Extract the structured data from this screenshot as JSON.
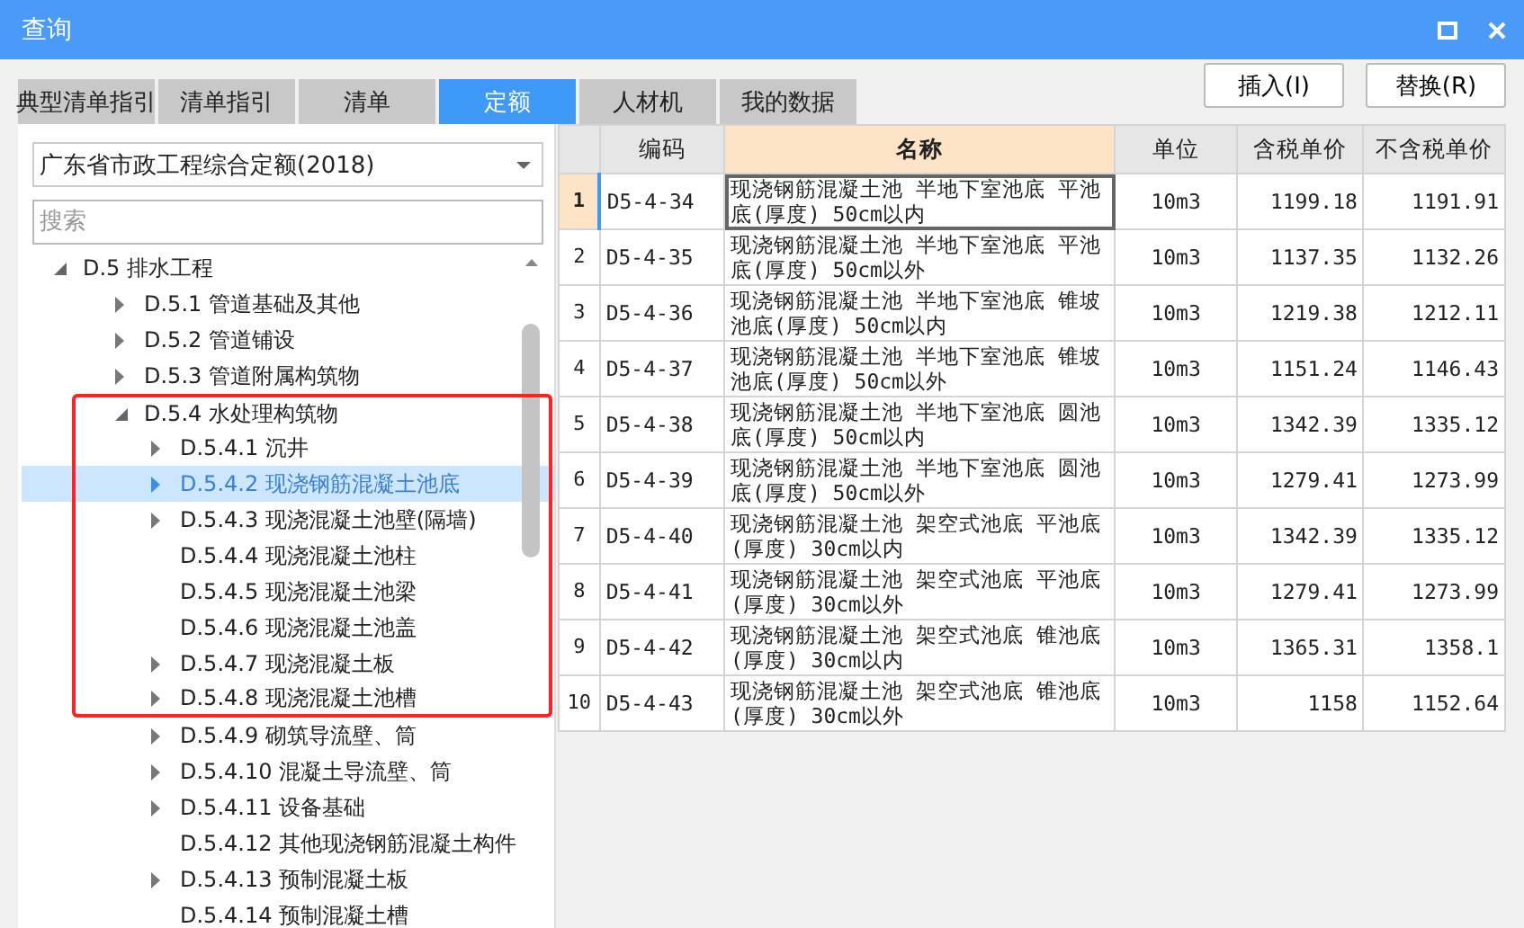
{
  "window": {
    "title": "查询"
  },
  "tabs": [
    {
      "label": "典型清单指引",
      "selected": false
    },
    {
      "label": "清单指引",
      "selected": false
    },
    {
      "label": "清单",
      "selected": false
    },
    {
      "label": "定额",
      "selected": true
    },
    {
      "label": "人材机",
      "selected": false
    },
    {
      "label": "我的数据",
      "selected": false
    }
  ],
  "buttons": [
    "插入(I)",
    "替换(R)"
  ],
  "library_select": {
    "value": "广东省市政工程综合定额(2018)"
  },
  "search": {
    "placeholder": "搜索"
  },
  "tree": [
    {
      "label": "D.5 排水工程",
      "expanded": true,
      "selected": false,
      "highlighted": false,
      "children": [
        {
          "label": "D.5.1 管道基础及其他",
          "expanded": false,
          "selected": false,
          "highlighted": false
        },
        {
          "label": "D.5.2 管道铺设",
          "expanded": false,
          "selected": false,
          "highlighted": false
        },
        {
          "label": "D.5.3 管道附属构筑物",
          "expanded": false,
          "selected": false,
          "highlighted": false
        },
        {
          "label": "D.5.4 水处理构筑物",
          "expanded": true,
          "selected": false,
          "highlighted": true,
          "children": [
            {
              "label": "D.5.4.1 沉井",
              "expanded": false,
              "selected": false,
              "highlighted": true
            },
            {
              "label": "D.5.4.2 现浇钢筋混凝土池底",
              "expanded": false,
              "selected": true,
              "highlighted": true
            },
            {
              "label": "D.5.4.3 现浇混凝土池壁(隔墙)",
              "expanded": false,
              "selected": false,
              "highlighted": true
            },
            {
              "label": "D.5.4.4 现浇混凝土池柱",
              "selected": false,
              "highlighted": true
            },
            {
              "label": "D.5.4.5 现浇混凝土池梁",
              "selected": false,
              "highlighted": true
            },
            {
              "label": "D.5.4.6 现浇混凝土池盖",
              "selected": false,
              "highlighted": true
            },
            {
              "label": "D.5.4.7 现浇混凝土板",
              "expanded": false,
              "selected": false,
              "highlighted": true
            },
            {
              "label": "D.5.4.8 现浇混凝土池槽",
              "expanded": false,
              "selected": false,
              "highlighted": true
            },
            {
              "label": "D.5.4.9 砌筑导流壁、筒",
              "expanded": false,
              "selected": false,
              "highlighted": false
            },
            {
              "label": "D.5.4.10 混凝土导流壁、筒",
              "expanded": false,
              "selected": false,
              "highlighted": false
            },
            {
              "label": "D.5.4.11 设备基础",
              "expanded": false,
              "selected": false,
              "highlighted": false
            },
            {
              "label": "D.5.4.12 其他现浇钢筋混凝土构件",
              "selected": false,
              "highlighted": false
            },
            {
              "label": "D.5.4.13 预制混凝土板",
              "expanded": false,
              "selected": false,
              "highlighted": false
            },
            {
              "label": "D.5.4.14 预制混凝土槽",
              "selected": false,
              "highlighted": false
            }
          ]
        }
      ]
    }
  ],
  "table": {
    "columns": [
      {
        "label": "编码",
        "selected": false
      },
      {
        "label": "名称",
        "selected": true
      },
      {
        "label": "单位",
        "selected": false
      },
      {
        "label": "含税单价",
        "selected": false
      },
      {
        "label": "不含税单价",
        "selected": false
      }
    ],
    "rows": [
      {
        "index": "1",
        "selected": true,
        "cells": [
          "D5-4-34",
          "现浇钢筋混凝土池 半地下室池底 平池底(厚度) 50cm以内",
          "10m3",
          "1199.18",
          "1191.91"
        ]
      },
      {
        "index": "2",
        "selected": false,
        "cells": [
          "D5-4-35",
          "现浇钢筋混凝土池 半地下室池底 平池底(厚度) 50cm以外",
          "10m3",
          "1137.35",
          "1132.26"
        ]
      },
      {
        "index": "3",
        "selected": false,
        "cells": [
          "D5-4-36",
          "现浇钢筋混凝土池 半地下室池底 锥坡池底(厚度) 50cm以内",
          "10m3",
          "1219.38",
          "1212.11"
        ]
      },
      {
        "index": "4",
        "selected": false,
        "cells": [
          "D5-4-37",
          "现浇钢筋混凝土池 半地下室池底 锥坡池底(厚度) 50cm以外",
          "10m3",
          "1151.24",
          "1146.43"
        ]
      },
      {
        "index": "5",
        "selected": false,
        "cells": [
          "D5-4-38",
          "现浇钢筋混凝土池 半地下室池底 圆池底(厚度) 50cm以内",
          "10m3",
          "1342.39",
          "1335.12"
        ]
      },
      {
        "index": "6",
        "selected": false,
        "cells": [
          "D5-4-39",
          "现浇钢筋混凝土池 半地下室池底 圆池底(厚度) 50cm以外",
          "10m3",
          "1279.41",
          "1273.99"
        ]
      },
      {
        "index": "7",
        "selected": false,
        "cells": [
          "D5-4-40",
          "现浇钢筋混凝土池 架空式池底 平池底(厚度) 30cm以内",
          "10m3",
          "1342.39",
          "1335.12"
        ]
      },
      {
        "index": "8",
        "selected": false,
        "cells": [
          "D5-4-41",
          "现浇钢筋混凝土池 架空式池底 平池底(厚度) 30cm以外",
          "10m3",
          "1279.41",
          "1273.99"
        ]
      },
      {
        "index": "9",
        "selected": false,
        "cells": [
          "D5-4-42",
          "现浇钢筋混凝土池 架空式池底 锥池底(厚度) 30cm以内",
          "10m3",
          "1365.31",
          "1358.1"
        ]
      },
      {
        "index": "10",
        "selected": false,
        "cells": [
          "D5-4-43",
          "现浇钢筋混凝土池 架空式池底 锥池底(厚度) 30cm以外",
          "10m3",
          "1158",
          "1152.64"
        ]
      }
    ]
  }
}
